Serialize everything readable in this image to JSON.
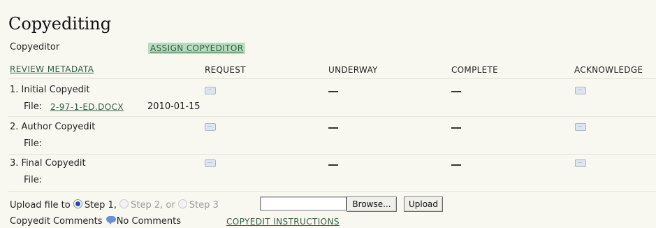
{
  "section": {
    "title": "Copyediting"
  },
  "copyeditor": {
    "label": "Copyeditor",
    "assign_label": "ASSIGN COPYEDITOR"
  },
  "table": {
    "review_metadata": "REVIEW METADATA",
    "headers": [
      "REQUEST",
      "UNDERWAY",
      "COMPLETE",
      "ACKNOWLEDGE"
    ],
    "rows": [
      {
        "step": "1. Initial Copyedit",
        "file_label": "File:",
        "file_link": "2-97-1-ED.DOCX",
        "file_date": "2010-01-15"
      },
      {
        "step": "2. Author Copyedit",
        "file_label": "File:",
        "file_link": "",
        "file_date": ""
      },
      {
        "step": "3. Final Copyedit",
        "file_label": "File:",
        "file_link": "",
        "file_date": ""
      }
    ]
  },
  "upload": {
    "prefix": "Upload file to",
    "step1": "Step 1,",
    "step2": "Step 2, or",
    "step3": "Step 3",
    "browse_label": "Browse...",
    "upload_label": "Upload"
  },
  "comments": {
    "label": "Copyedit Comments",
    "status": "No Comments",
    "instructions": "COPYEDIT INSTRUCTIONS"
  },
  "icons": {
    "request": "email-icon",
    "acknowledge": "email-icon",
    "comment": "comment-bubble-icon"
  }
}
